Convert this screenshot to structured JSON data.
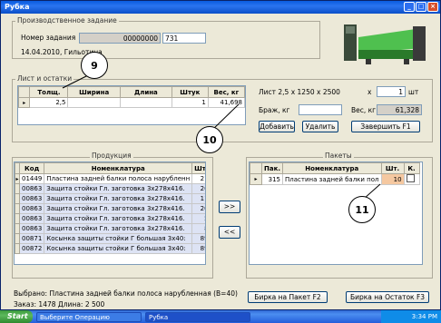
{
  "window": {
    "title": "Рубка"
  },
  "task": {
    "group_label": "Производственное задание",
    "number_label": "Номер задания",
    "number_value": "00000000",
    "number_extra": "731",
    "date_line": "14.04.2010, Гильотина"
  },
  "sheet": {
    "group_label": "Лист и остатки",
    "columns": [
      "Толщ.",
      "Ширина",
      "Длина",
      "Штук",
      "Вес, кг"
    ],
    "rows": [
      {
        "thickness": "2,5",
        "width": "",
        "length": "",
        "count": "1",
        "weight": "41,698"
      }
    ],
    "info_label": "Лист 2,5 x 1250 x 2500",
    "x_label": "x",
    "qty_value": "1",
    "unit_label": "шт",
    "scrap_label": "Браж, кг",
    "scrap_value": "",
    "weight_label": "Вес, кг",
    "weight_value": "61,328",
    "add_button": "Добавить",
    "delete_button": "Удалить",
    "finish_button": "Завершить F1"
  },
  "products": {
    "group_label": "Продукция",
    "columns": [
      "Код",
      "Номенклатура",
      "Шт."
    ],
    "rows": [
      {
        "code": "01449",
        "name": "Пластина задней балки полоса нарубленн",
        "qty": "21"
      },
      {
        "code": "00863",
        "name": "Защита стойки Гл. заготовка 3х278х416.",
        "qty": "26"
      },
      {
        "code": "00863",
        "name": "Защита стойки Гл. заготовка 3х278х416.",
        "qty": "11"
      },
      {
        "code": "00863",
        "name": "Защита стойки Гл. заготовка 3х278х416.",
        "qty": "20"
      },
      {
        "code": "00863",
        "name": "Защита стойки Гл. заготовка 3х278х416.",
        "qty": "5"
      },
      {
        "code": "00863",
        "name": "Защита стойки Гл. заготовка 3х278х416.",
        "qty": "8"
      },
      {
        "code": "00871",
        "name": "Косынка защиты стойки Г большая 3х40:",
        "qty": "89"
      },
      {
        "code": "00872",
        "name": "Косынка защиты стойки Г большая 3х40:",
        "qty": "89"
      }
    ],
    "selected_label": "Выбрано: Пластина задней балки полоса нарубленная (B=40)",
    "order_label": "Заказ: 1478  Длина: 2 500"
  },
  "transfer": {
    "right": ">>",
    "left": "<<"
  },
  "packages": {
    "group_label": "Пакеты",
    "columns": [
      "Пак.",
      "Номенклатура",
      "Шт.",
      "К."
    ],
    "rows": [
      {
        "pack": "315",
        "name": "Пластина задней балки пол",
        "qty": "10"
      }
    ],
    "tag_package_button": "Бирка на Пакет F2",
    "tag_remainder_button": "Бирка на Остаток F3"
  },
  "callouts": {
    "c9": "9",
    "c10": "10",
    "c11": "11"
  },
  "taskbar": {
    "start": "Start",
    "task1": "Выберите Операцию",
    "task2": "Рубка",
    "clock": "3:34 PM"
  },
  "colors": {
    "titlebar": "#0a5ce0",
    "highlight_qty": "#f5c8a0",
    "row_blue": "#dde3f4"
  }
}
